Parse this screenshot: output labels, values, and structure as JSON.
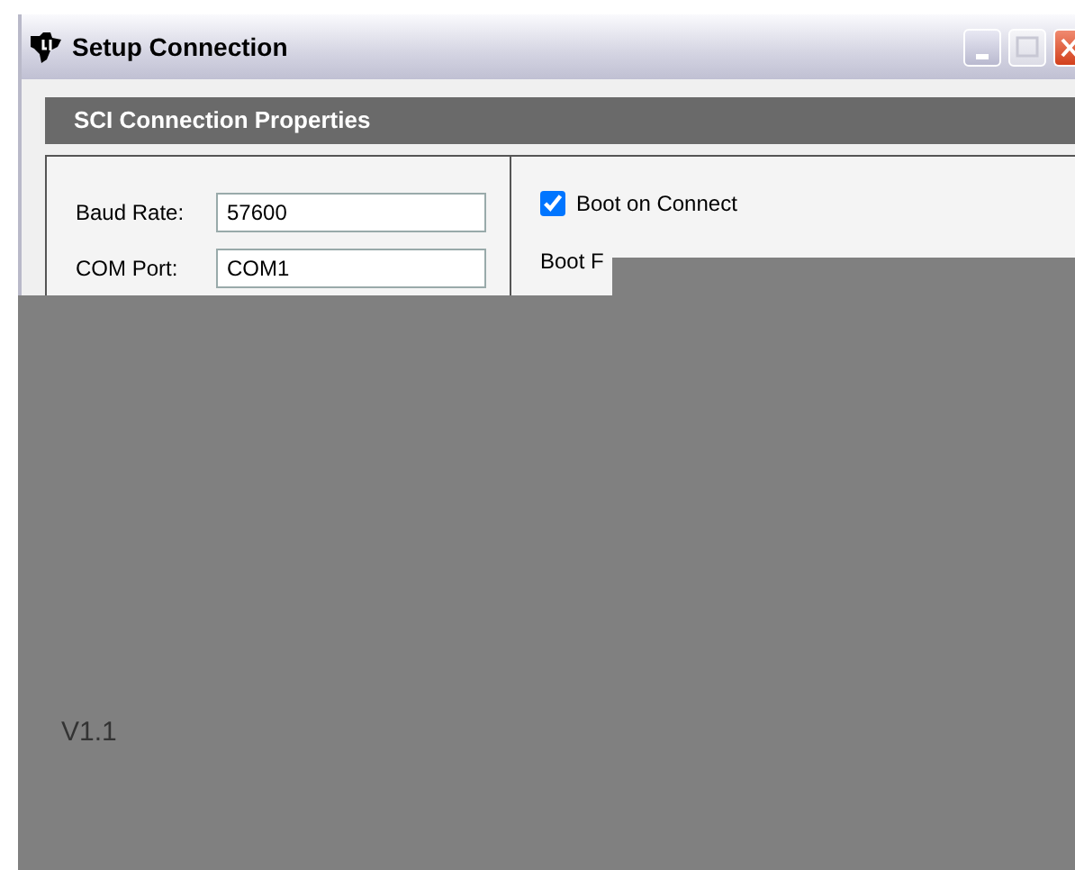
{
  "window": {
    "title": "Setup Connection"
  },
  "section": {
    "title": "SCI Connection Properties"
  },
  "fields": [
    {
      "label": "Baud Rate:",
      "value": "57600"
    },
    {
      "label": "COM Port:",
      "value": "COM1"
    }
  ],
  "boot_on_connect": {
    "label": "Boot on Connect",
    "checked": true
  },
  "boot_file": {
    "label": "Boot F"
  },
  "version": "V1.1"
}
